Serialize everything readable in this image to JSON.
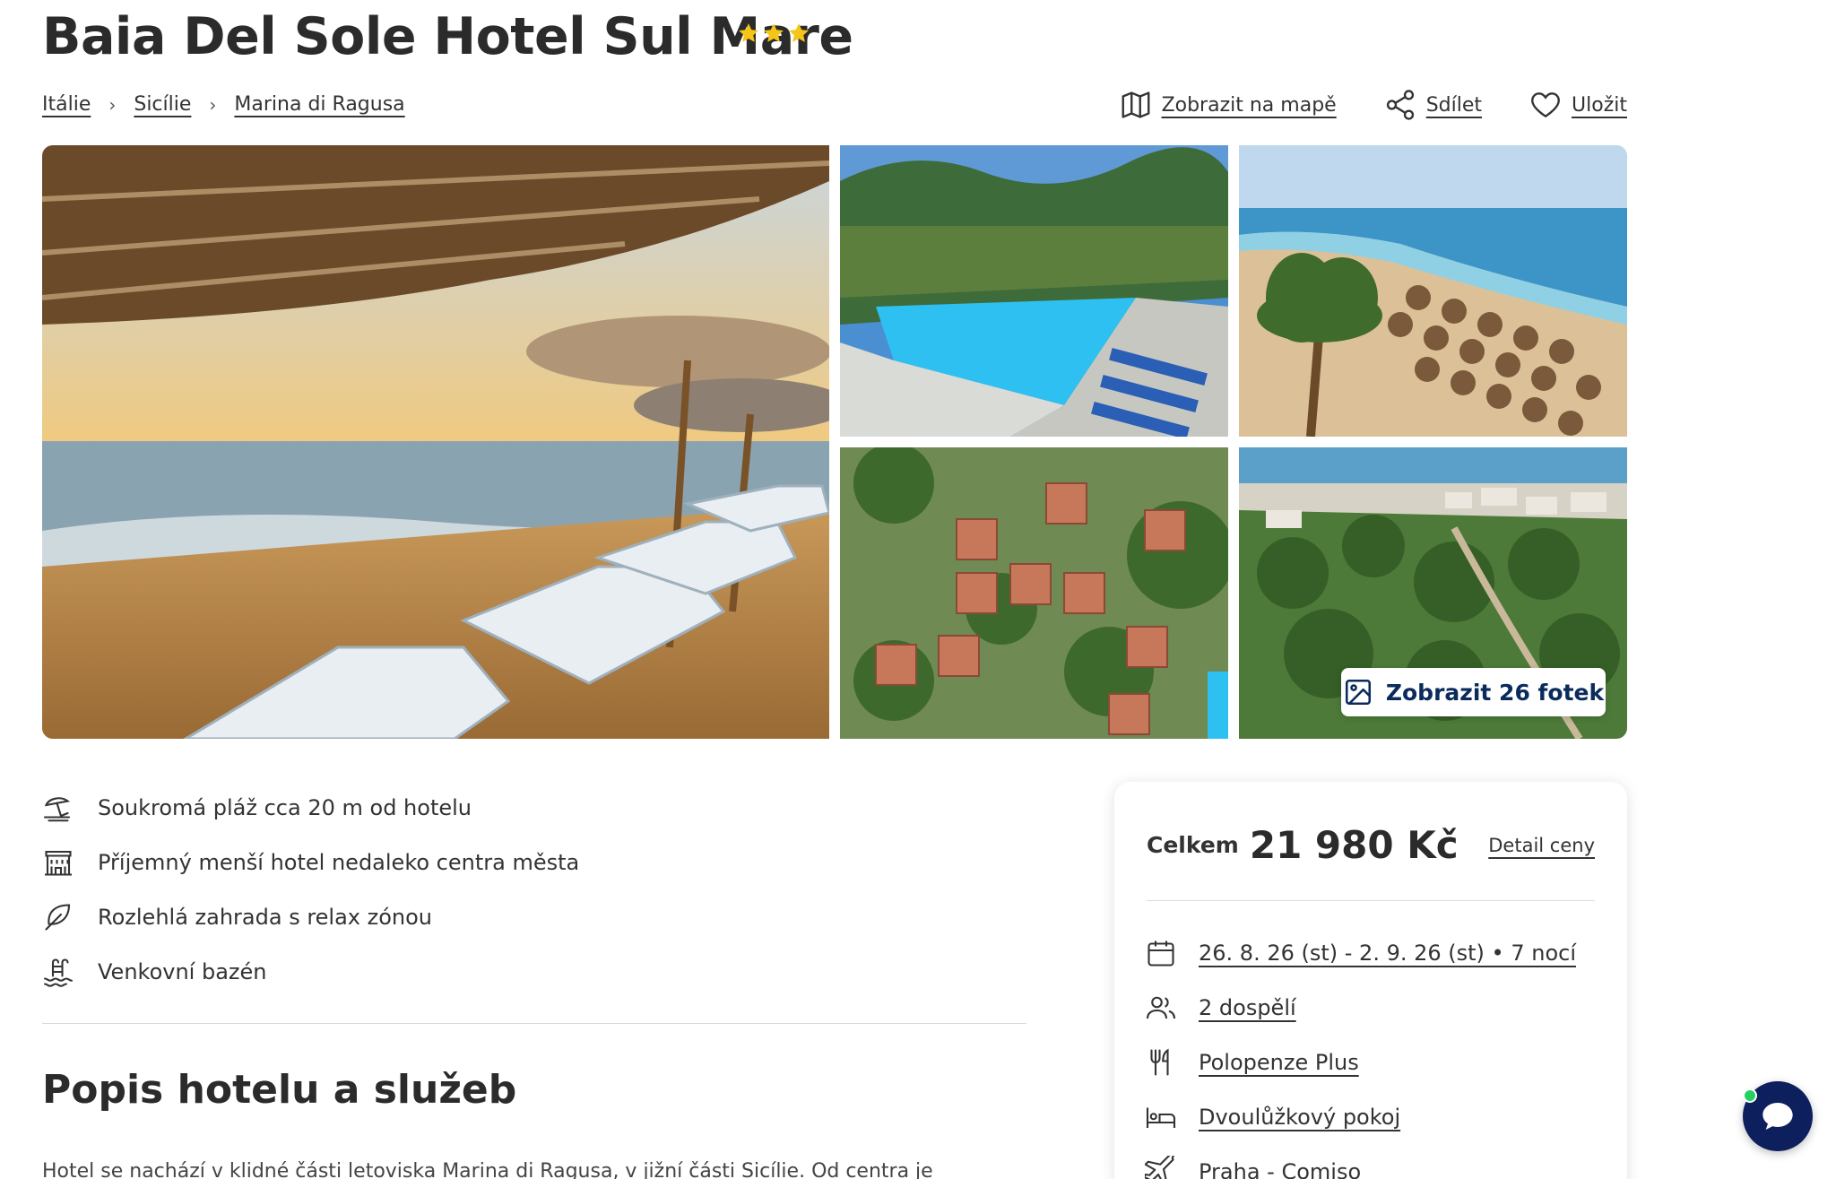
{
  "hotel": {
    "name": "Baia Del Sole Hotel Sul Mare",
    "stars": 3
  },
  "breadcrumb": [
    "Itálie",
    "Sicílie",
    "Marina di Ragusa"
  ],
  "actions": {
    "map": "Zobrazit na mapě",
    "share": "Sdílet",
    "save": "Uložit"
  },
  "gallery": {
    "button_label": "Zobrazit 26 fotek"
  },
  "features": [
    {
      "icon": "beach-umbrella-icon",
      "text": "Soukromá pláž cca 20 m od hotelu"
    },
    {
      "icon": "hotel-building-icon",
      "text": "Příjemný menší hotel nedaleko centra města"
    },
    {
      "icon": "leaf-icon",
      "text": "Rozlehlá zahrada s relax zónou"
    },
    {
      "icon": "pool-icon",
      "text": "Venkovní bazén"
    }
  ],
  "description": {
    "title": "Popis hotelu a služeb",
    "text": "Hotel se nachází v klidné části letoviska Marina di Ragusa, v jižní části Sicílie. Od centra je"
  },
  "price_card": {
    "label": "Celkem",
    "price": "21 980 Kč",
    "detail_link": "Detail ceny",
    "items": [
      {
        "icon": "calendar-icon",
        "text": "26. 8. 26 (st) - 2. 9. 26 (st) • 7 nocí"
      },
      {
        "icon": "people-icon",
        "text": "2 dospělí"
      },
      {
        "icon": "cutlery-icon",
        "text": "Polopenze Plus"
      },
      {
        "icon": "bed-icon",
        "text": "Dvoulůžkový pokoj"
      },
      {
        "icon": "plane-icon",
        "text": "Praha - Comiso"
      }
    ]
  },
  "colors": {
    "star": "#f5c518",
    "brand_navy": "#0d1f5c",
    "online_dot": "#23d160"
  }
}
